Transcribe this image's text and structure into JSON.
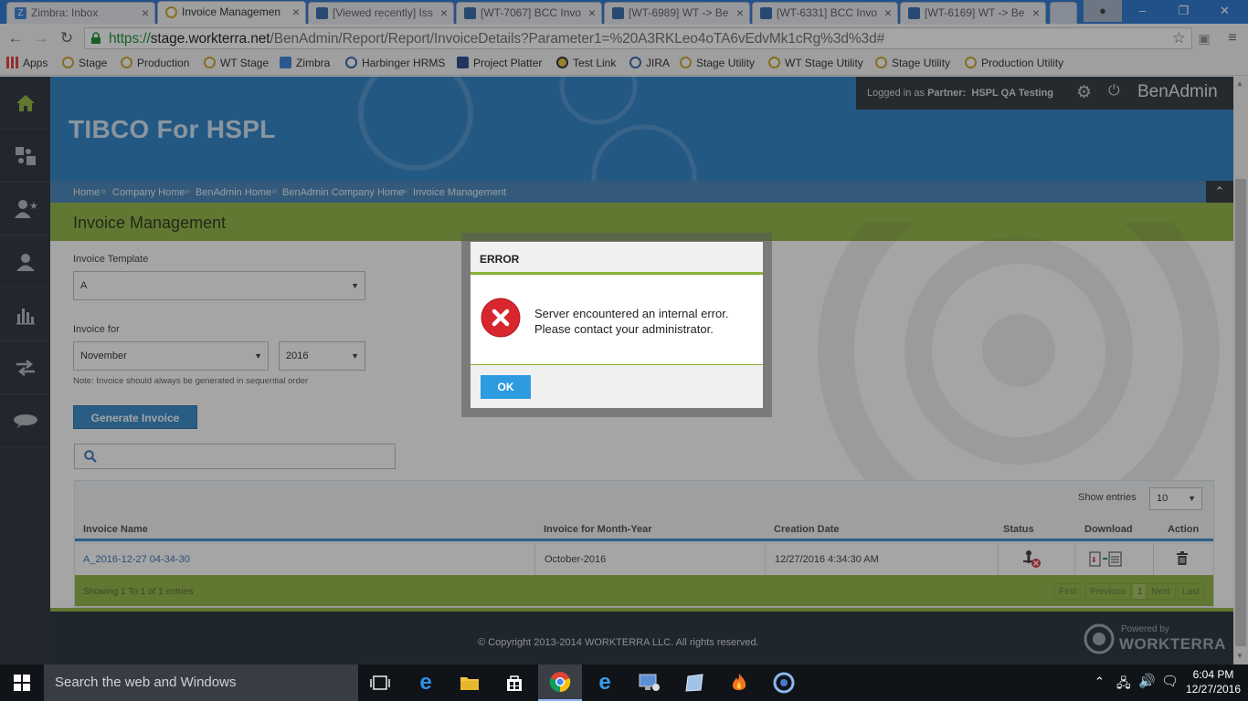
{
  "browser": {
    "tabs": [
      {
        "label": "Zimbra: Inbox",
        "active": false
      },
      {
        "label": "Invoice Managemen",
        "active": true
      },
      {
        "label": "[Viewed recently] Iss",
        "active": false
      },
      {
        "label": "[WT-7067] BCC Invo",
        "active": false
      },
      {
        "label": "[WT-6989] WT -> Be",
        "active": false
      },
      {
        "label": "[WT-6331] BCC Invo",
        "active": false
      },
      {
        "label": "[WT-6169] WT -> Be",
        "active": false
      }
    ],
    "url_scheme": "https://",
    "url_host": "stage.workterra.net",
    "url_path": "/BenAdmin/Report/Report/InvoiceDetails?Parameter1=%20A3RKLeo4oTA6vEdvMk1cRg%3d%3d#",
    "bookmarks": [
      "Apps",
      "Stage",
      "Production",
      "WT Stage",
      "Zimbra",
      "Harbinger HRMS",
      "Project Platter",
      "Test Link",
      "JIRA",
      "Stage Utility",
      "WT Stage Utility",
      "Stage Utility",
      "Production Utility"
    ]
  },
  "header": {
    "site_title": "TIBCO For HSPL",
    "logged_in_prefix": "Logged in as",
    "logged_in_role": "Partner:",
    "logged_in_user": "HSPL QA Testing",
    "app_name": "BenAdmin"
  },
  "breadcrumb": [
    "Home",
    "Company Home",
    "BenAdmin Home",
    "BenAdmin Company Home",
    "Invoice Management"
  ],
  "page": {
    "title": "Invoice Management",
    "template_label": "Invoice Template",
    "template_value": "A",
    "invoice_for_label": "Invoice for",
    "month_value": "November",
    "year_value": "2016",
    "note": "Note: Invoice should always be generated in sequential order",
    "generate_label": "Generate Invoice",
    "search_placeholder": ""
  },
  "table": {
    "show_entries_label": "Show entries",
    "show_entries_value": "10",
    "columns": [
      "Invoice Name",
      "Invoice for Month-Year",
      "Creation Date",
      "Status",
      "Download",
      "Action"
    ],
    "rows": [
      {
        "name": "A_2016-12-27 04-34-30",
        "month_year": "October-2016",
        "created": "12/27/2016 4:34:30 AM"
      }
    ],
    "showing_text": "Showing 1 To 1 of 1 entries",
    "pager": [
      "First",
      "Previous",
      "1",
      "Next",
      "Last"
    ]
  },
  "footer": {
    "copyright": "© Copyright 2013-2014 WORKTERRA LLC. All rights reserved.",
    "powered_by": "Powered by",
    "brand": "WORKTERRA"
  },
  "dialog": {
    "title": "ERROR",
    "message_line1": "Server encountered an internal error.",
    "message_line2": "Please contact your administrator.",
    "ok_label": "OK"
  },
  "taskbar": {
    "search_text": "Search the web and Windows",
    "time": "6:04 PM",
    "date": "12/27/2016"
  },
  "colors": {
    "banner_blue": "#1f7bc4",
    "accent_green": "#8bb23a",
    "sidebar_dark": "#1d2730",
    "error_red": "#d8262e",
    "ok_blue": "#2c9be0"
  }
}
